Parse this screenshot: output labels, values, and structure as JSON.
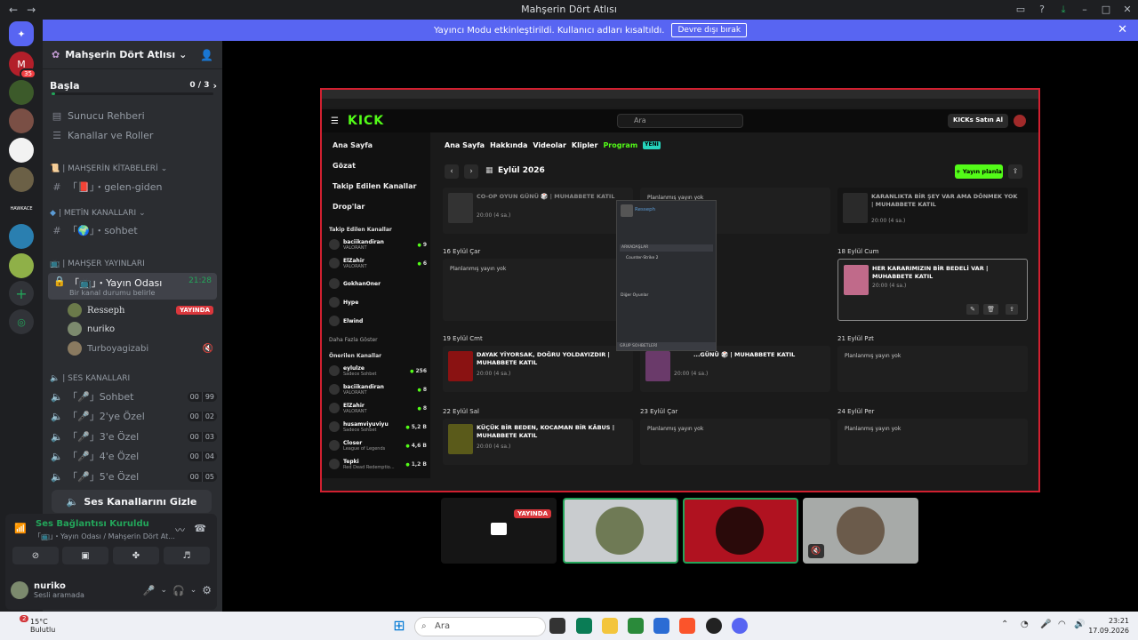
{
  "titlebar": {
    "title": "Mahşerin Dört Atlısı"
  },
  "banner": {
    "text": "Yayıncı Modu etkinleştirildi. Kullanıcı adları kısaltıldı.",
    "button": "Devre dışı bırak"
  },
  "rail": {
    "badge_mentions": "35"
  },
  "sidebar": {
    "guild_name": "Mahşerin Dört Atlısı",
    "onboarding": {
      "label": "Başla",
      "progress": "0 / 3"
    },
    "items": [
      {
        "label": "Sunucu Rehberi"
      },
      {
        "label": "Kanallar ve Roller"
      }
    ],
    "cat_books": "| MAHŞERİN KİTABELERİ",
    "ch_gelen": "「📕」・gelen-giden",
    "cat_text": "| METİN KANALLARI",
    "ch_sohbet": "「🌍」・sohbet",
    "cat_streams": "| MAHŞER YAYINLARI",
    "ch_stream": {
      "name": "「📺」・Yayın Odası",
      "time": "21:28",
      "status": "Bir kanal durumu belirle"
    },
    "voice_users": [
      {
        "name": "Resseph",
        "live": "YAYINDA"
      },
      {
        "name": "nuriko"
      },
      {
        "name": "Turboyagizabi"
      }
    ],
    "cat_voice": "| Ses Kanalları",
    "voice_channels": [
      {
        "name": "「🎤」Sohbet",
        "a": "00",
        "b": "99"
      },
      {
        "name": "「🎤」2'ye Özel",
        "a": "00",
        "b": "02"
      },
      {
        "name": "「🎤」3'e Özel",
        "a": "00",
        "b": "03"
      },
      {
        "name": "「🎤」4'e Özel",
        "a": "00",
        "b": "04"
      },
      {
        "name": "「🎤」5'e Özel",
        "a": "00",
        "b": "05"
      }
    ],
    "hide_voice": "Ses Kanallarını Gizle"
  },
  "voice_panel": {
    "status": "Ses Bağlantısı Kuruldu",
    "channel": "「📺」・Yayın Odası / Mahşerin Dört At...",
    "username": "nuriko",
    "user_status": "Sesli aramada"
  },
  "stream": {
    "search_placeholder": "Ara",
    "buy_button": "KICKs Satın Al",
    "logo": "KICK",
    "nav": [
      {
        "label": "Ana Sayfa"
      },
      {
        "label": "Gözat"
      },
      {
        "label": "Takip Edilen Kanallar"
      },
      {
        "label": "Drop'lar"
      }
    ],
    "followed_header": "Takip Edilen Kanallar",
    "followed": [
      {
        "name": "baciikandiran",
        "game": "VALORANT",
        "count": "9"
      },
      {
        "name": "ElZahir",
        "game": "VALORANT",
        "count": "6"
      },
      {
        "name": "GokhanOner",
        "game": "",
        "count": ""
      },
      {
        "name": "Hype",
        "game": "",
        "count": ""
      },
      {
        "name": "Elwind",
        "game": "",
        "count": ""
      }
    ],
    "show_more": "Daha Fazla Göster",
    "recommended_header": "Önerilen Kanallar",
    "recommended": [
      {
        "name": "eylulze",
        "game": "Sadece Sohbet",
        "count": "256"
      },
      {
        "name": "baciikandiran",
        "game": "VALORANT",
        "count": "8"
      },
      {
        "name": "ElZahir",
        "game": "VALORANT",
        "count": "8"
      },
      {
        "name": "husamviyuviyu",
        "game": "Sadece Sohbet",
        "count": "5,2 B"
      },
      {
        "name": "Closer",
        "game": "League of Legends",
        "count": "4,6 B"
      },
      {
        "name": "Tepki",
        "game": "Red Dead Redemptio...",
        "count": "1,2 B"
      }
    ],
    "tabs": [
      {
        "label": "Ana Sayfa"
      },
      {
        "label": "Hakkında"
      },
      {
        "label": "Videolar"
      },
      {
        "label": "Klipler"
      },
      {
        "label": "Program"
      }
    ],
    "new_badge": "YENİ",
    "month": "Eylül 2026",
    "schedule_button": "+ Yayın planla",
    "cells": {
      "c1_title": "CO-OP OYUN GÜNÜ 🎲 | MUHABBETE KATIL",
      "c1_time": "20:00 (4 sa.)",
      "c2": "Planlanmış yayın yok",
      "c3_title": "KARANLIKTA BİR ŞEY VAR AMA DÖNMEK YOK | MUHABBETE KATIL",
      "c3_time": "20:00 (4 sa.)",
      "d16": "16 Eylül Çar",
      "d16_text": "Planlanmış yayın yok",
      "d18": "18 Eylül Cum",
      "d18_title": "HER KARARIMIZIN BİR BEDELİ VAR | MUHABBETE KATIL",
      "d18_time": "20:00 (4 sa.)",
      "d19": "19 Eylül Cmt",
      "d19_title": "DAYAK YİYORSAK, DOĞRU YOLDAYIZDIR | MUHABBETE KATIL",
      "d19_time": "20:00 (4 sa.)",
      "d20_title": "...GÜNÜ 🎲 | MUHABBETE KATIL",
      "d20_time": "20:00 (4 sa.)",
      "d21": "21 Eylül Pzt",
      "d21_text": "Planlanmış yayın yok",
      "d22": "22 Eylül Sal",
      "d22_title": "KÜÇÜK BİR BEDEN, KOCAMAN BİR KÂBUS | MUHABBETE KATIL",
      "d22_time": "20:00 (4 sa.)",
      "d23": "23 Eylül Çar",
      "d23_text": "Planlanmış yayın yok",
      "d24": "24 Eylül Per",
      "d24_text": "Planlanmış yayın yok"
    },
    "popup": {
      "name": "Resseph",
      "section": "ARKADAŞLAR",
      "group": "Counter-Strike 2",
      "others": "Diğer Oyunlar",
      "footer": "GRUP SOHBETLERİ"
    }
  },
  "tiles": {
    "live": "YAYINDA"
  },
  "taskbar": {
    "temp": "15°C",
    "weather": "Bulutlu",
    "notif": "2",
    "search": "Ara",
    "time": "23:21",
    "date": "17.09.2026"
  }
}
